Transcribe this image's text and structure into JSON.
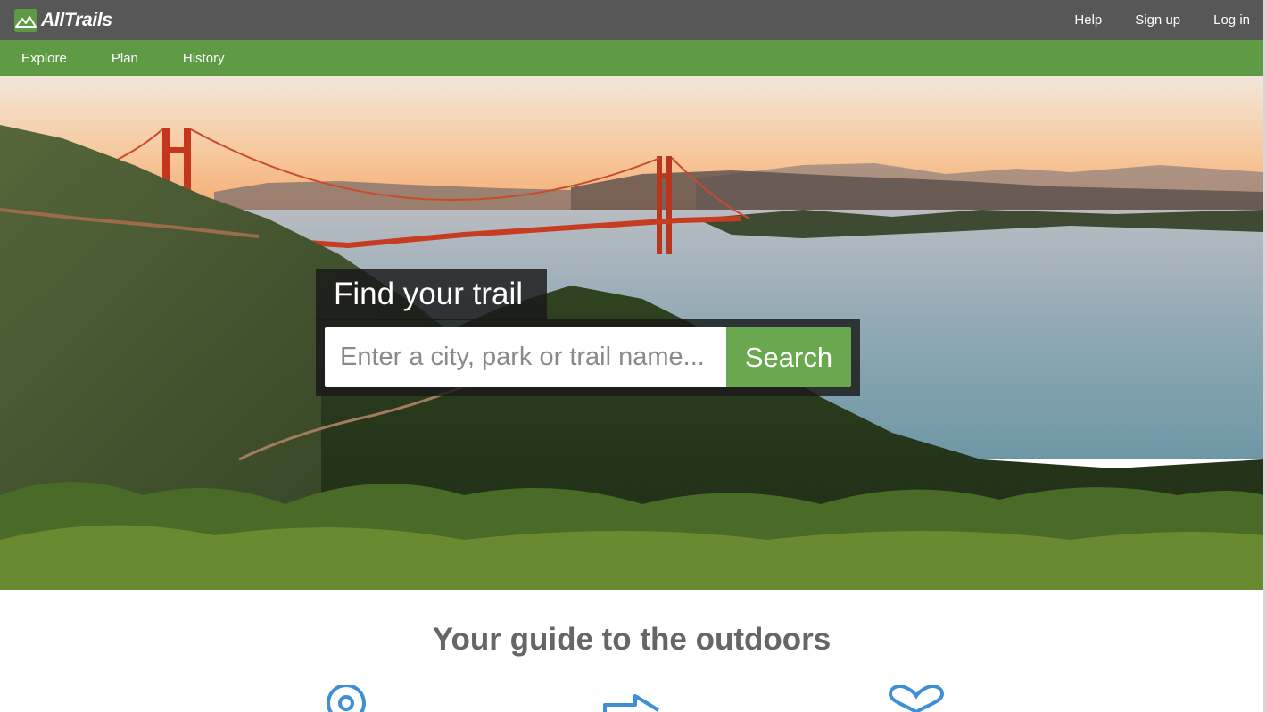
{
  "header": {
    "brand": "AllTrails",
    "links": {
      "help": "Help",
      "signup": "Sign up",
      "login": "Log in"
    }
  },
  "nav": {
    "explore": "Explore",
    "plan": "Plan",
    "history": "History"
  },
  "hero": {
    "heading": "Find your trail",
    "search_placeholder": "Enter a city, park or trail name...",
    "search_value": "",
    "search_button": "Search"
  },
  "guide": {
    "title": "Your guide to the outdoors",
    "icons": [
      "map-pin-icon",
      "directions-arrow-icon",
      "heart-icon"
    ]
  },
  "colors": {
    "header_bg": "#575757",
    "nav_bg": "#5f9a44",
    "accent_green": "#6aa84f",
    "icon_blue": "#3f8fd6",
    "title_gray": "#666666"
  }
}
